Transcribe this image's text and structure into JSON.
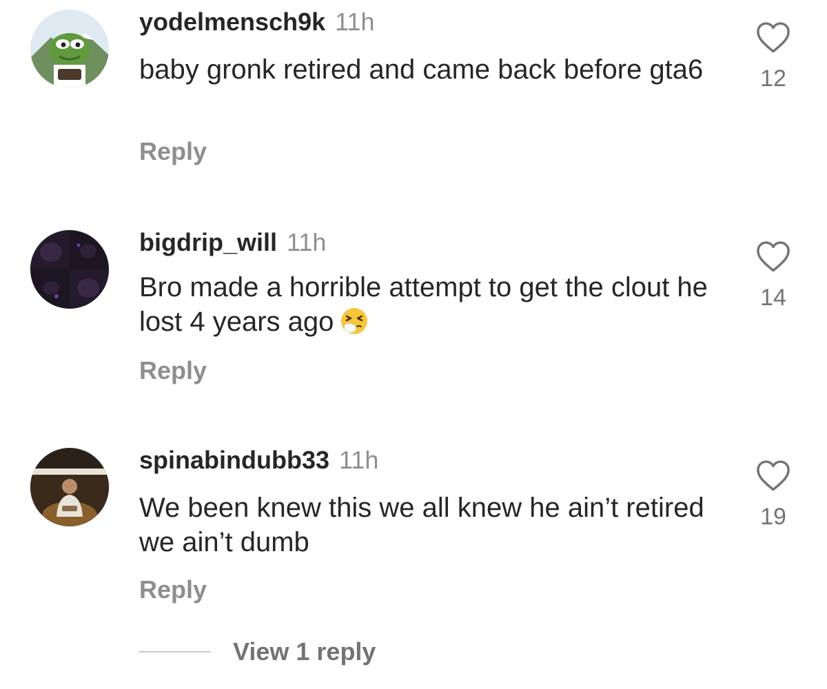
{
  "comments": [
    {
      "username": "yodelmensch9k",
      "time": "11h",
      "text": "baby gronk retired and came back before gta6",
      "reply_label": "Reply",
      "likes": "12",
      "avatar": "frog-avatar-icon"
    },
    {
      "username": "bigdrip_will",
      "time": "11h",
      "text": "Bro made a horrible attempt to get the clout he lost 4 years ago",
      "emoji": "sneezing-face-emoji-icon",
      "reply_label": "Reply",
      "likes": "14",
      "avatar": "dark-purple-avatar-icon"
    },
    {
      "username": "spinabindubb33",
      "time": "11h",
      "text": "We been knew this we all knew he ain’t retired we ain’t dumb",
      "reply_label": "Reply",
      "likes": "19",
      "avatar": "album-cover-avatar-icon"
    }
  ],
  "view_replies_label": "View 1 reply",
  "colors": {
    "text": "#262626",
    "secondary": "#8e8e8e",
    "background": "#ffffff"
  }
}
